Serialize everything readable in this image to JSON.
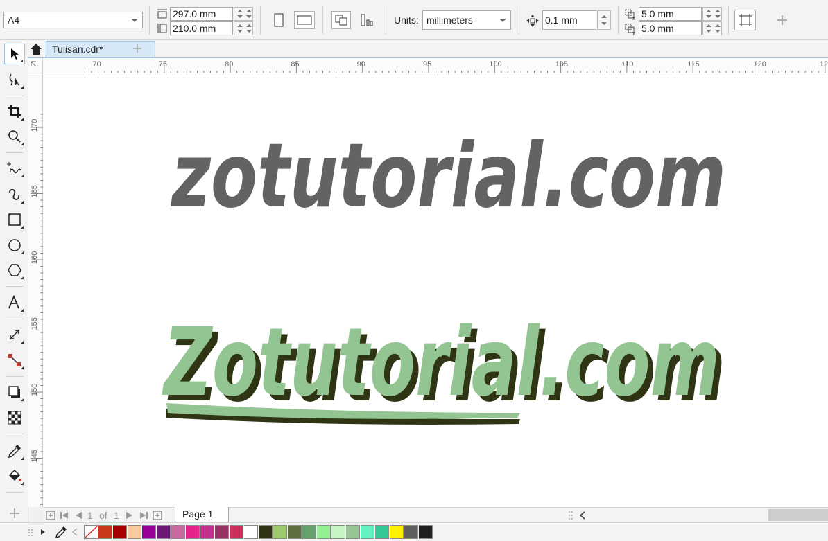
{
  "property_bar": {
    "page_size": "A4",
    "page_width": "297.0 mm",
    "page_height": "210.0 mm",
    "units_label": "Units:",
    "units_value": "millimeters",
    "nudge": "0.1 mm",
    "dup_x": "5.0 mm",
    "dup_y": "5.0 mm"
  },
  "tabs": {
    "document": "Tulisan.cdr*"
  },
  "ruler": {
    "h_ticks": [
      "70",
      "75",
      "80",
      "85",
      "90",
      "95",
      "100",
      "105",
      "110",
      "115",
      "120",
      "12"
    ],
    "v_ticks": [
      "170",
      "165",
      "160",
      "155",
      "150",
      "145"
    ]
  },
  "artwork": {
    "text_plain": "zotutorial.com",
    "text_styled": "Zotutorial.com",
    "plain_color": "#636363",
    "styled_fill": "#93c592",
    "styled_shadow": "#2e3414"
  },
  "page_nav": {
    "position": "1",
    "of_label": "of",
    "total": "1",
    "page_tab": "Page 1"
  },
  "palette": [
    "#c8391a",
    "#a80000",
    "#f9c9a0",
    "#960096",
    "#6a1a74",
    "#c86aa0",
    "#e8228c",
    "#c0308c",
    "#963264",
    "#cc2e58",
    "#ffffff",
    "#2e3414",
    "#9ec86c",
    "#5e6e3c",
    "#68a06e",
    "#92f092",
    "#c6f6c6",
    "#98c496",
    "#62f2c2",
    "#34c896",
    "#fff000",
    "#5e5e5e",
    "#1e1e1e"
  ]
}
